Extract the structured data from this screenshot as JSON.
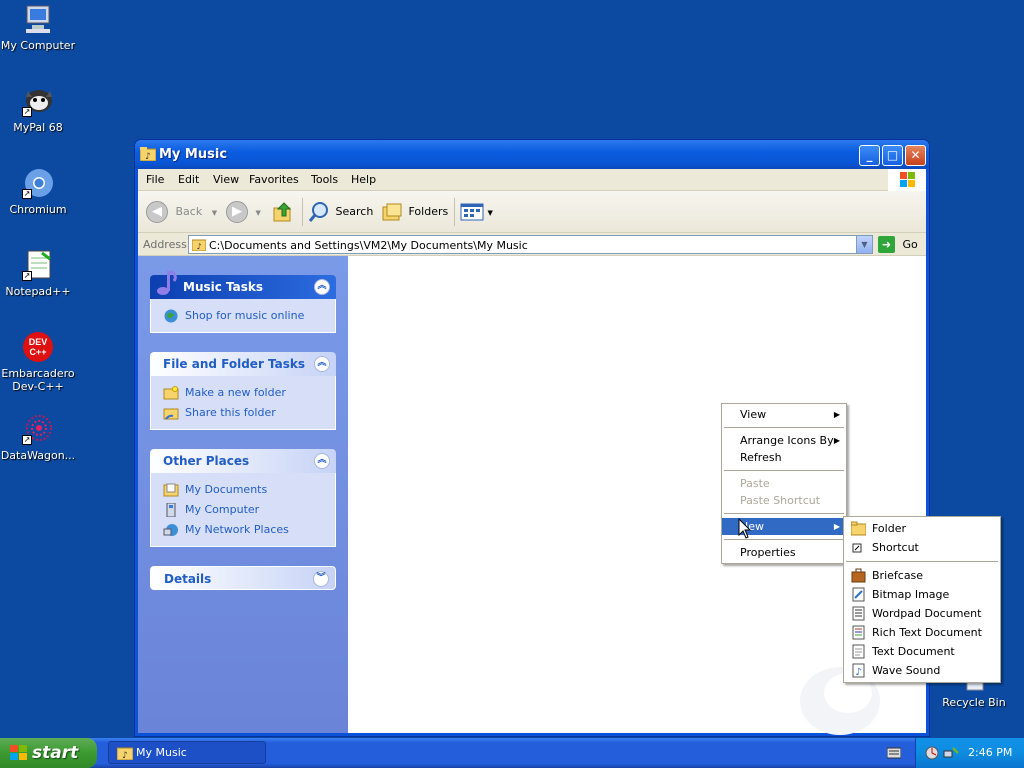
{
  "desktop": {
    "icons": [
      {
        "label": "My Computer",
        "icon": "my-computer-icon"
      },
      {
        "label": "MyPal 68",
        "icon": "mypal-icon"
      },
      {
        "label": "Chromium",
        "icon": "chromium-icon"
      },
      {
        "label": "Notepad++",
        "icon": "notepad-plus-plus-icon"
      },
      {
        "label": "Embarcadero Dev-C++",
        "icon": "dev-cpp-icon"
      },
      {
        "label": "DataWagon...",
        "icon": "datawagon-icon"
      },
      {
        "label": "Recycle Bin",
        "icon": "recycle-bin-icon"
      }
    ],
    "devcpp_badge": "DEV\nC++"
  },
  "window": {
    "title": "My Music",
    "menu": [
      "File",
      "Edit",
      "View",
      "Favorites",
      "Tools",
      "Help"
    ],
    "toolbar": {
      "back": "Back",
      "search": "Search",
      "folders": "Folders"
    },
    "address": {
      "label": "Address",
      "value": "C:\\Documents and Settings\\VM2\\My Documents\\My Music",
      "go": "Go"
    },
    "taskpane": {
      "music_tasks": {
        "title": "Music Tasks",
        "links": [
          "Shop for music online"
        ]
      },
      "file_folder_tasks": {
        "title": "File and Folder Tasks",
        "links": [
          "Make a new folder",
          "Share this folder"
        ]
      },
      "other_places": {
        "title": "Other Places",
        "links": [
          "My Documents",
          "My Computer",
          "My Network Places"
        ]
      },
      "details": {
        "title": "Details"
      }
    }
  },
  "context_menu": {
    "items": [
      {
        "label": "View",
        "submenu": true,
        "disabled": false
      },
      {
        "separator": true
      },
      {
        "label": "Arrange Icons By",
        "submenu": true,
        "disabled": false
      },
      {
        "label": "Refresh",
        "submenu": false,
        "disabled": false
      },
      {
        "separator": true
      },
      {
        "label": "Paste",
        "submenu": false,
        "disabled": true
      },
      {
        "label": "Paste Shortcut",
        "submenu": false,
        "disabled": true
      },
      {
        "separator": true
      },
      {
        "label": "New",
        "submenu": true,
        "disabled": false,
        "selected": true
      },
      {
        "separator": true
      },
      {
        "label": "Properties",
        "submenu": false,
        "disabled": false
      }
    ]
  },
  "new_submenu": {
    "items": [
      "Folder",
      "Shortcut",
      "Briefcase",
      "Bitmap Image",
      "Wordpad Document",
      "Rich Text Document",
      "Text Document",
      "Wave Sound"
    ]
  },
  "taskbar": {
    "start": "start",
    "task": "My Music",
    "clock": "2:46 PM"
  },
  "colors": {
    "desktop": "#0b4aa0",
    "titlebar": "#0a5de0",
    "menu_highlight": "#316ac5",
    "taskpane_link": "#215dc6",
    "start_green": "#3c9a31"
  }
}
